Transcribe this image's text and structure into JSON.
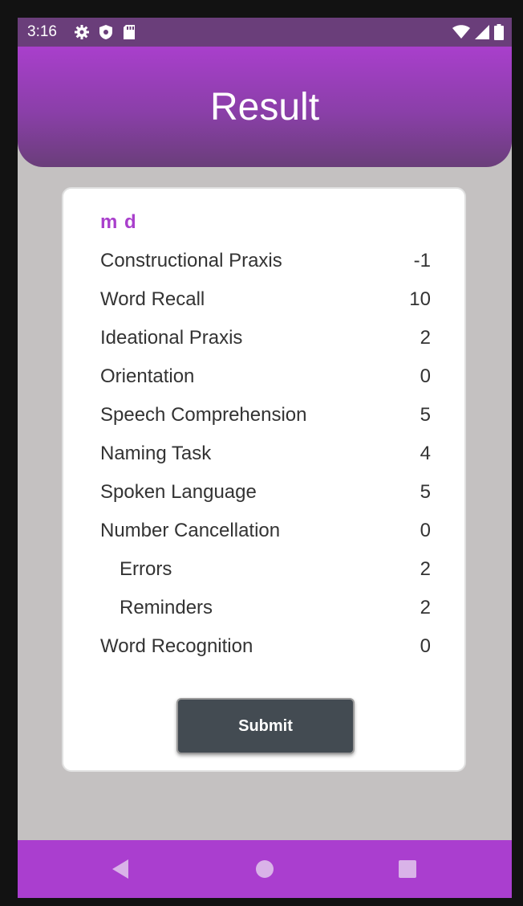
{
  "status_bar": {
    "time": "3:16",
    "left_icons": [
      "gear-icon",
      "shield-icon",
      "sd-card-icon"
    ],
    "right_icons": [
      "wifi-icon",
      "signal-icon",
      "battery-icon"
    ]
  },
  "header": {
    "title": "Result"
  },
  "card": {
    "user_name": "m d",
    "scores": [
      {
        "label": "Constructional Praxis",
        "value": "-1"
      },
      {
        "label": "Word Recall",
        "value": "10"
      },
      {
        "label": "Ideational Praxis",
        "value": "2"
      },
      {
        "label": "Orientation",
        "value": "0"
      },
      {
        "label": "Speech Comprehension",
        "value": "5"
      },
      {
        "label": "Naming Task",
        "value": "4"
      },
      {
        "label": "Spoken Language",
        "value": "5"
      },
      {
        "label": "Number Cancellation",
        "value": "0"
      },
      {
        "label": "Errors",
        "value": "2"
      },
      {
        "label": "Reminders",
        "value": "2"
      },
      {
        "label": "Word Recognition",
        "value": "0"
      }
    ],
    "submit_label": "Submit"
  },
  "nav_bar": {
    "buttons": [
      "back-icon",
      "home-icon",
      "recents-icon"
    ]
  },
  "colors": {
    "accent": "#aa3ecf",
    "header_dark": "#6a3e7a",
    "background": "#c4c1c1",
    "button": "#434b52"
  }
}
